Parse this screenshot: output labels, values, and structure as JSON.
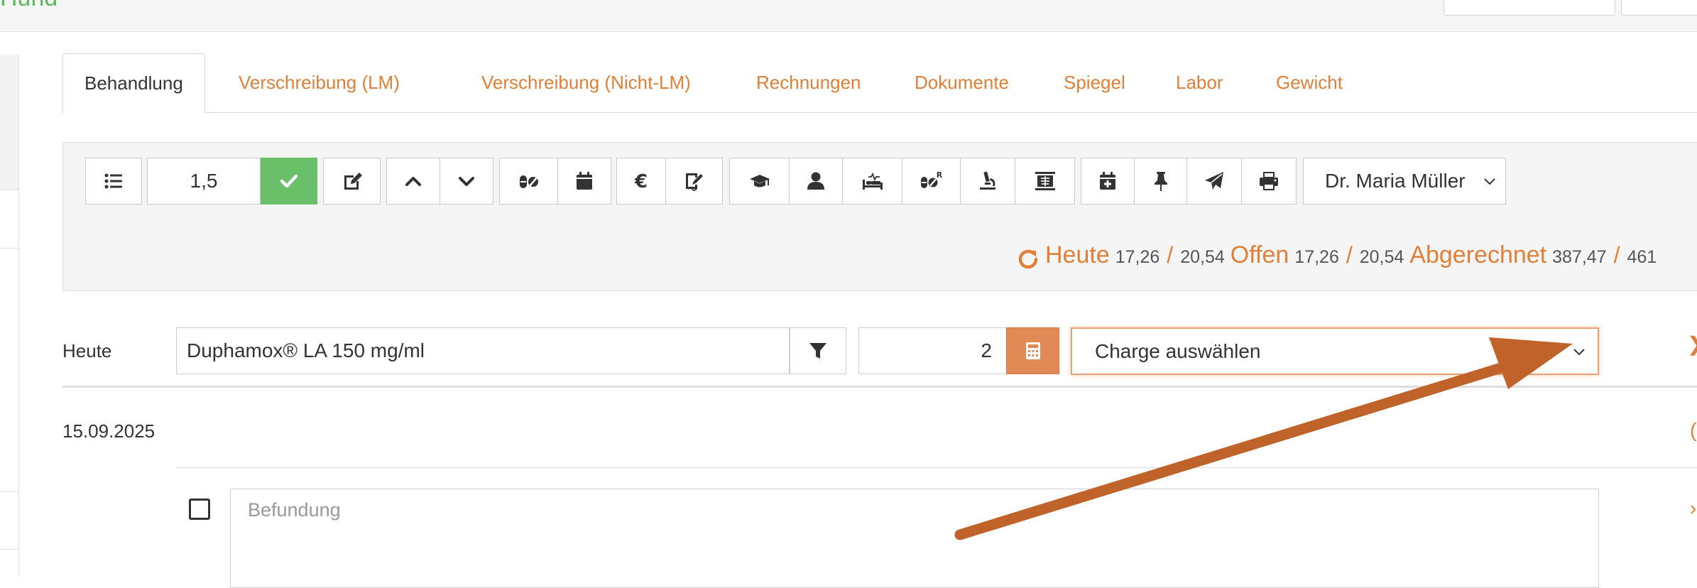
{
  "app": {
    "brand": "Hund"
  },
  "tabs": [
    {
      "label": "Behandlung",
      "active": true
    },
    {
      "label": "Verschreibung (LM)"
    },
    {
      "label": "Verschreibung (Nicht-LM)"
    },
    {
      "label": "Rechnungen"
    },
    {
      "label": "Dokumente"
    },
    {
      "label": "Spiegel"
    },
    {
      "label": "Labor"
    },
    {
      "label": "Gewicht"
    }
  ],
  "toolbar": {
    "factor_value": "1,5",
    "doctor_select": "Dr. Maria Müller",
    "buttons": [
      "list-icon",
      "check-icon",
      "edit-icon",
      "chevron-up-icon",
      "chevron-down-icon",
      "pills-icon",
      "calendar-icon",
      "euro-icon",
      "signature-icon",
      "graduation-cap-icon",
      "user-icon",
      "procedures-bed-icon",
      "pills-rx-icon",
      "microscope-icon",
      "xray-icon",
      "calendar-plus-icon",
      "pin-icon",
      "send-icon",
      "print-icon"
    ]
  },
  "summary": {
    "heute_label": "Heute",
    "heute_a": "17,26",
    "heute_b": "20,54",
    "offen_label": "Offen",
    "offen_a": "17,26",
    "offen_b": "20,54",
    "abgerechnet_label": "Abgerechnet",
    "abgerechnet_a": "387,47",
    "abgerechnet_b": "461",
    "separator": "/"
  },
  "entry": {
    "row_label": "Heute",
    "drug_value": "Duphamox® LA 150 mg/ml",
    "quantity_value": "2",
    "charge_placeholder": "Charge auswählen"
  },
  "history": {
    "date": "15.09.2025",
    "findings_placeholder": "Befundung"
  },
  "colors": {
    "accent": "#e07f38",
    "success": "#6abf69",
    "arrow": "#c0632a"
  }
}
